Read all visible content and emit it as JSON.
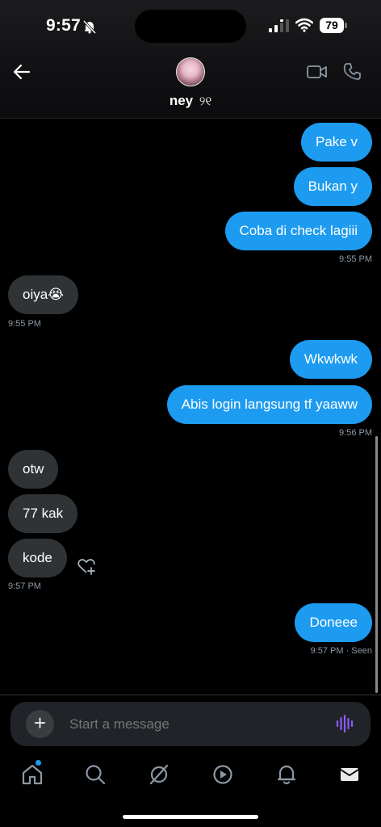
{
  "status_bar": {
    "time": "9:57",
    "battery": "79"
  },
  "header": {
    "contact_name": "ney",
    "name_suffix": "୨୧"
  },
  "messages": [
    {
      "text": "Pake v"
    },
    {
      "text": "Bukan y"
    },
    {
      "text": "Coba di check lagiii"
    },
    {
      "time": "9:55 PM"
    },
    {
      "text": "oiya😭"
    },
    {
      "time": "9:55 PM"
    },
    {
      "text": "Wkwkwk"
    },
    {
      "text": "Abis login langsung tf yaaww"
    },
    {
      "time": "9:56 PM"
    },
    {
      "text": "otw"
    },
    {
      "text": "77 kak"
    },
    {
      "text": "kode"
    },
    {
      "time": "9:57 PM"
    },
    {
      "text": "Doneee"
    },
    {
      "time": "9:57 PM · Seen"
    }
  ],
  "composer": {
    "placeholder": "Start a message"
  },
  "colors": {
    "accent": "#1d9bf0",
    "incoming_bubble": "#2f3336",
    "voice_icon": "#8b5cf6"
  },
  "nav": [
    "home-icon",
    "search-icon",
    "grok-icon",
    "video-icon",
    "bell-icon",
    "mail-icon"
  ]
}
